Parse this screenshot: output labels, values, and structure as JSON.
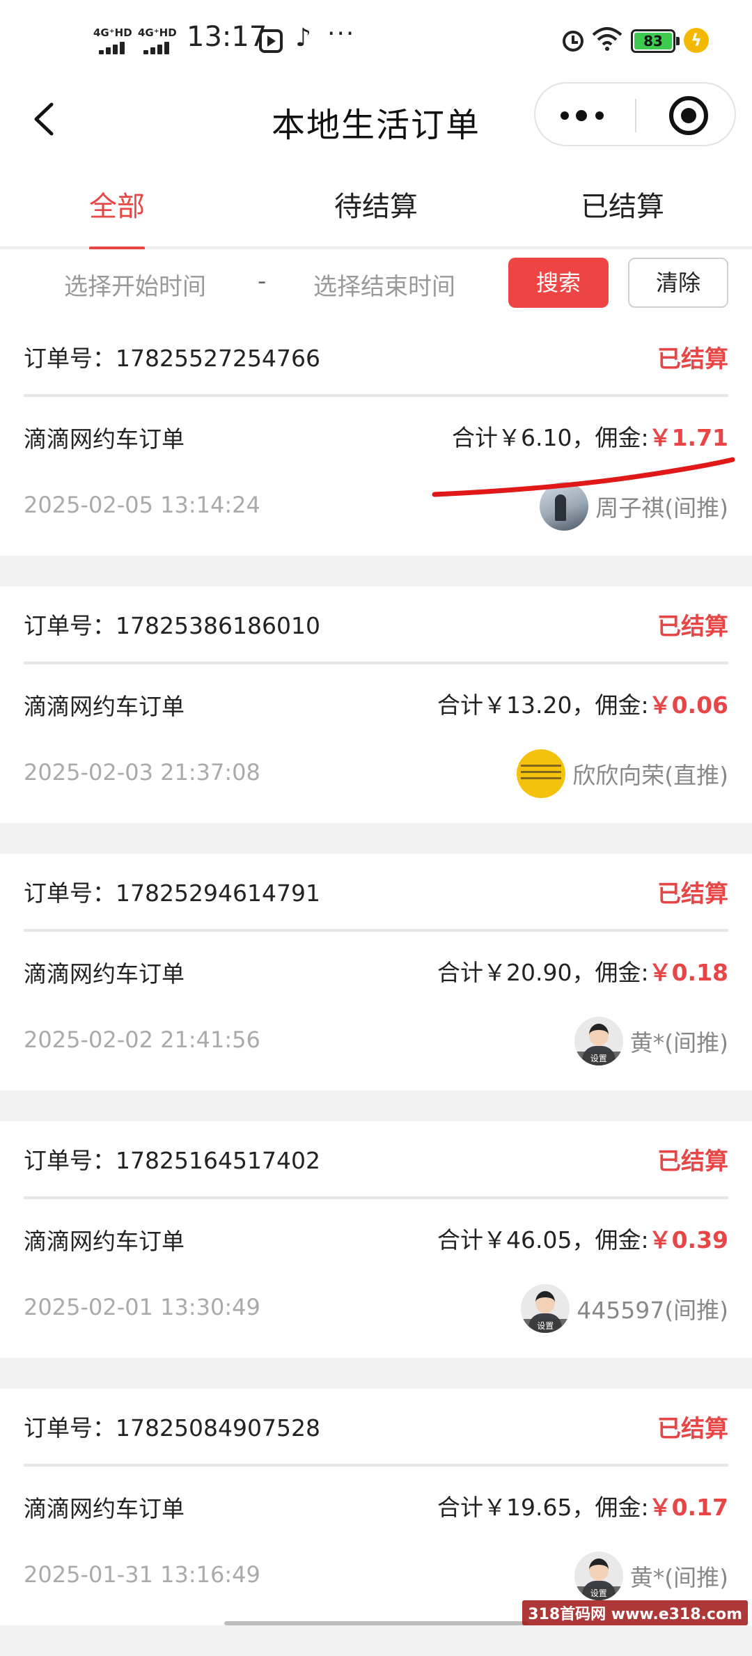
{
  "status_bar": {
    "signal1": "4G⁺HD",
    "signal2": "4G⁺HD",
    "time": "13:17",
    "more": "···",
    "battery": "83"
  },
  "nav": {
    "title": "本地生活订单"
  },
  "tabs": [
    {
      "label": "全部",
      "active": true
    },
    {
      "label": "待结算",
      "active": false
    },
    {
      "label": "已结算",
      "active": false
    }
  ],
  "filter": {
    "start_placeholder": "选择开始时间",
    "separator": "-",
    "end_placeholder": "选择结束时间",
    "search_label": "搜索",
    "clear_label": "清除"
  },
  "orders": [
    {
      "order_label": "订单号：17825527254766",
      "status": "已结算",
      "product": "滴滴网约车订单",
      "total": "合计￥6.10，",
      "commission_label": "佣金:",
      "commission": "￥1.71",
      "time": "2025-02-05 13:14:24",
      "user": "周子祺(间推)",
      "avatar": "photo"
    },
    {
      "order_label": "订单号：17825386186010",
      "status": "已结算",
      "product": "滴滴网约车订单",
      "total": "合计￥13.20，",
      "commission_label": "佣金:",
      "commission": "￥0.06",
      "time": "2025-02-03 21:37:08",
      "user": "欣欣向荣(直推)",
      "avatar": "yellow"
    },
    {
      "order_label": "订单号：17825294614791",
      "status": "已结算",
      "product": "滴滴网约车订单",
      "total": "合计￥20.90，",
      "commission_label": "佣金:",
      "commission": "￥0.18",
      "time": "2025-02-02 21:41:56",
      "user": "黄*(间推)",
      "avatar": "default"
    },
    {
      "order_label": "订单号：17825164517402",
      "status": "已结算",
      "product": "滴滴网约车订单",
      "total": "合计￥46.05，",
      "commission_label": "佣金:",
      "commission": "￥0.39",
      "time": "2025-02-01 13:30:49",
      "user": "445597(间推)",
      "avatar": "default"
    },
    {
      "order_label": "订单号：17825084907528",
      "status": "已结算",
      "product": "滴滴网约车订单",
      "total": "合计￥19.65，",
      "commission_label": "佣金:",
      "commission": "￥0.17",
      "time": "2025-01-31 13:16:49",
      "user": "黄*(间推)",
      "avatar": "default"
    }
  ],
  "avatar_default_text": "设置",
  "watermark": "318首码网 www.e318.com",
  "colors": {
    "accent_red": "#e84646",
    "search_button": "#ef4444",
    "battery_green": "#3ec94f"
  }
}
